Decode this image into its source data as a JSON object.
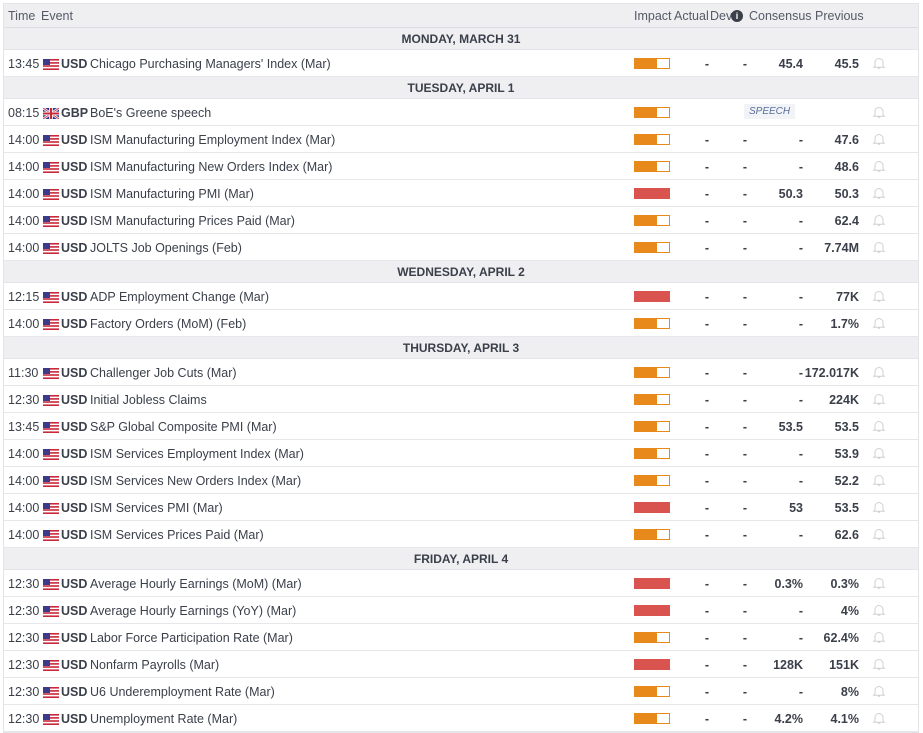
{
  "header": {
    "time": "Time",
    "event": "Event",
    "impact": "Impact",
    "actual": "Actual",
    "dev": "Dev",
    "dev_info": "i",
    "consensus": "Consensus",
    "previous": "Previous"
  },
  "colors": {
    "medium": "#e8891c",
    "high": "#d9534f"
  },
  "days": [
    {
      "label": "MONDAY, MARCH 31",
      "events": [
        {
          "time": "13:45",
          "flag": "us",
          "currency": "USD",
          "event": "Chicago Purchasing Managers' Index (Mar)",
          "impact": "medium",
          "actual": "-",
          "dev": "-",
          "consensus": "45.4",
          "previous": "45.5"
        }
      ]
    },
    {
      "label": "TUESDAY, APRIL 1",
      "events": [
        {
          "time": "08:15",
          "flag": "gb",
          "currency": "GBP",
          "event": "BoE's Greene speech",
          "impact": "medium",
          "badge": "SPEECH"
        },
        {
          "time": "14:00",
          "flag": "us",
          "currency": "USD",
          "event": "ISM Manufacturing Employment Index (Mar)",
          "impact": "medium",
          "actual": "-",
          "dev": "-",
          "consensus": "-",
          "previous": "47.6"
        },
        {
          "time": "14:00",
          "flag": "us",
          "currency": "USD",
          "event": "ISM Manufacturing New Orders Index (Mar)",
          "impact": "medium",
          "actual": "-",
          "dev": "-",
          "consensus": "-",
          "previous": "48.6"
        },
        {
          "time": "14:00",
          "flag": "us",
          "currency": "USD",
          "event": "ISM Manufacturing PMI (Mar)",
          "impact": "high",
          "actual": "-",
          "dev": "-",
          "consensus": "50.3",
          "previous": "50.3"
        },
        {
          "time": "14:00",
          "flag": "us",
          "currency": "USD",
          "event": "ISM Manufacturing Prices Paid (Mar)",
          "impact": "medium",
          "actual": "-",
          "dev": "-",
          "consensus": "-",
          "previous": "62.4"
        },
        {
          "time": "14:00",
          "flag": "us",
          "currency": "USD",
          "event": "JOLTS Job Openings (Feb)",
          "impact": "medium",
          "actual": "-",
          "dev": "-",
          "consensus": "-",
          "previous": "7.74M"
        }
      ]
    },
    {
      "label": "WEDNESDAY, APRIL 2",
      "events": [
        {
          "time": "12:15",
          "flag": "us",
          "currency": "USD",
          "event": "ADP Employment Change (Mar)",
          "impact": "high",
          "actual": "-",
          "dev": "-",
          "consensus": "-",
          "previous": "77K"
        },
        {
          "time": "14:00",
          "flag": "us",
          "currency": "USD",
          "event": "Factory Orders (MoM) (Feb)",
          "impact": "medium",
          "actual": "-",
          "dev": "-",
          "consensus": "-",
          "previous": "1.7%"
        }
      ]
    },
    {
      "label": "THURSDAY, APRIL 3",
      "events": [
        {
          "time": "11:30",
          "flag": "us",
          "currency": "USD",
          "event": "Challenger Job Cuts (Mar)",
          "impact": "medium",
          "actual": "-",
          "dev": "-",
          "consensus": "-",
          "previous": "172.017K"
        },
        {
          "time": "12:30",
          "flag": "us",
          "currency": "USD",
          "event": "Initial Jobless Claims",
          "impact": "medium",
          "actual": "-",
          "dev": "-",
          "consensus": "-",
          "previous": "224K"
        },
        {
          "time": "13:45",
          "flag": "us",
          "currency": "USD",
          "event": "S&P Global Composite PMI (Mar)",
          "impact": "medium",
          "actual": "-",
          "dev": "-",
          "consensus": "53.5",
          "previous": "53.5"
        },
        {
          "time": "14:00",
          "flag": "us",
          "currency": "USD",
          "event": "ISM Services Employment Index (Mar)",
          "impact": "medium",
          "actual": "-",
          "dev": "-",
          "consensus": "-",
          "previous": "53.9"
        },
        {
          "time": "14:00",
          "flag": "us",
          "currency": "USD",
          "event": "ISM Services New Orders Index (Mar)",
          "impact": "medium",
          "actual": "-",
          "dev": "-",
          "consensus": "-",
          "previous": "52.2"
        },
        {
          "time": "14:00",
          "flag": "us",
          "currency": "USD",
          "event": "ISM Services PMI (Mar)",
          "impact": "high",
          "actual": "-",
          "dev": "-",
          "consensus": "53",
          "previous": "53.5"
        },
        {
          "time": "14:00",
          "flag": "us",
          "currency": "USD",
          "event": "ISM Services Prices Paid (Mar)",
          "impact": "medium",
          "actual": "-",
          "dev": "-",
          "consensus": "-",
          "previous": "62.6"
        }
      ]
    },
    {
      "label": "FRIDAY, APRIL 4",
      "events": [
        {
          "time": "12:30",
          "flag": "us",
          "currency": "USD",
          "event": "Average Hourly Earnings (MoM) (Mar)",
          "impact": "high",
          "actual": "-",
          "dev": "-",
          "consensus": "0.3%",
          "previous": "0.3%"
        },
        {
          "time": "12:30",
          "flag": "us",
          "currency": "USD",
          "event": "Average Hourly Earnings (YoY) (Mar)",
          "impact": "high",
          "actual": "-",
          "dev": "-",
          "consensus": "-",
          "previous": "4%"
        },
        {
          "time": "12:30",
          "flag": "us",
          "currency": "USD",
          "event": "Labor Force Participation Rate (Mar)",
          "impact": "medium",
          "actual": "-",
          "dev": "-",
          "consensus": "-",
          "previous": "62.4%"
        },
        {
          "time": "12:30",
          "flag": "us",
          "currency": "USD",
          "event": "Nonfarm Payrolls (Mar)",
          "impact": "high",
          "actual": "-",
          "dev": "-",
          "consensus": "128K",
          "previous": "151K"
        },
        {
          "time": "12:30",
          "flag": "us",
          "currency": "USD",
          "event": "U6 Underemployment Rate (Mar)",
          "impact": "medium",
          "actual": "-",
          "dev": "-",
          "consensus": "-",
          "previous": "8%"
        },
        {
          "time": "12:30",
          "flag": "us",
          "currency": "USD",
          "event": "Unemployment Rate (Mar)",
          "impact": "medium",
          "actual": "-",
          "dev": "-",
          "consensus": "4.2%",
          "previous": "4.1%"
        }
      ]
    }
  ]
}
